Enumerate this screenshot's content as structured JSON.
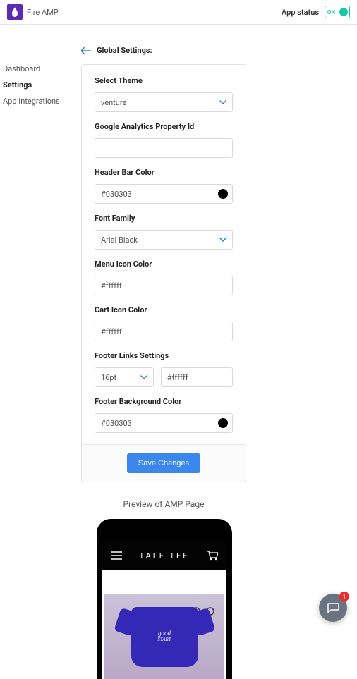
{
  "header": {
    "app_name": "Fire AMP",
    "status_label": "App status",
    "toggle_text": "ON"
  },
  "sidebar": {
    "items": [
      {
        "label": "Dashboard"
      },
      {
        "label": "Settings"
      },
      {
        "label": "App Integrations"
      }
    ],
    "active_index": 1
  },
  "page": {
    "title": "Global Settings:"
  },
  "form": {
    "theme": {
      "label": "Select Theme",
      "value": "venture"
    },
    "ga_property": {
      "label": "Google Analytics Property Id",
      "value": ""
    },
    "header_color": {
      "label": "Header Bar Color",
      "value": "#030303",
      "swatch": "#030303"
    },
    "font_family": {
      "label": "Font Family",
      "value": "Arial Black"
    },
    "menu_icon_color": {
      "label": "Menu Icon Color",
      "value": "#ffffff"
    },
    "cart_icon_color": {
      "label": "Cart Icon Color",
      "value": "#ffffff"
    },
    "footer_links": {
      "label": "Footer Links Settings",
      "size": "16pt",
      "color": "#ffffff"
    },
    "footer_bg": {
      "label": "Footer Background Color",
      "value": "#030303",
      "swatch": "#030303"
    },
    "save_label": "Save Changes"
  },
  "preview": {
    "label": "Preview of AMP Page",
    "site_title": "TALE TEE",
    "shirt_text_1": "good",
    "shirt_text_2": "START"
  },
  "chat": {
    "badge": "1"
  }
}
